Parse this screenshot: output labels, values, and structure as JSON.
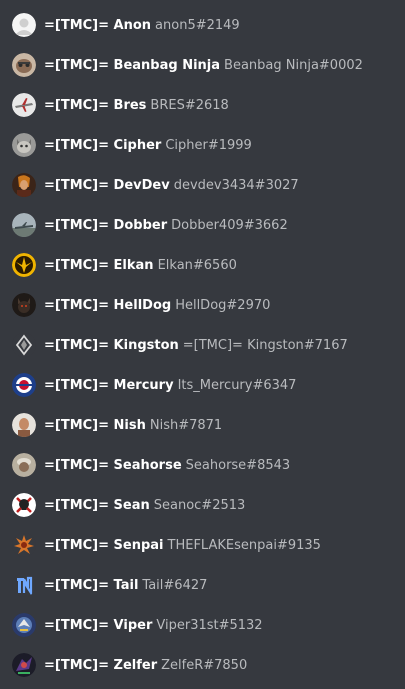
{
  "members": [
    {
      "nickname": "=[TMC]= Anon",
      "username": "anon5#2149",
      "avatar_icon": "default-user-avatar-icon"
    },
    {
      "nickname": "=[TMC]= Beanbag Ninja",
      "username": "Beanbag Ninja#0002",
      "avatar_icon": "cat-avatar-icon"
    },
    {
      "nickname": "=[TMC]= Bres",
      "username": "BRES#2618",
      "avatar_icon": "airplane-avatar-icon"
    },
    {
      "nickname": "=[TMC]= Cipher",
      "username": "Cipher#1999",
      "avatar_icon": "cat-avatar-icon"
    },
    {
      "nickname": "=[TMC]= DevDev",
      "username": "devdev3434#3027",
      "avatar_icon": "character-avatar-icon"
    },
    {
      "nickname": "=[TMC]= Dobber",
      "username": "Dobber409#3662",
      "avatar_icon": "jet-avatar-icon"
    },
    {
      "nickname": "=[TMC]= Elkan",
      "username": "Elkan#6560",
      "avatar_icon": "emblem-avatar-icon"
    },
    {
      "nickname": "=[TMC]= HellDog",
      "username": "HellDog#2970",
      "avatar_icon": "dog-avatar-icon"
    },
    {
      "nickname": "=[TMC]= Kingston",
      "username": "=[TMC]= Kingston#7167",
      "avatar_icon": "wings-logo-avatar-icon"
    },
    {
      "nickname": "=[TMC]= Mercury",
      "username": "Its_Mercury#6347",
      "avatar_icon": "roundel-avatar-icon"
    },
    {
      "nickname": "=[TMC]= Nish",
      "username": "Nish#7871",
      "avatar_icon": "photo-avatar-icon"
    },
    {
      "nickname": "=[TMC]= Seahorse",
      "username": "Seahorse#8543",
      "avatar_icon": "photo-avatar-icon"
    },
    {
      "nickname": "=[TMC]= Sean",
      "username": "Seanoc#2513",
      "avatar_icon": "skull-avatar-icon"
    },
    {
      "nickname": "=[TMC]= Senpai",
      "username": "THEFLAKEsenpai#9135",
      "avatar_icon": "splash-avatar-icon"
    },
    {
      "nickname": "=[TMC]= Tail",
      "username": "Tail#6427",
      "avatar_icon": "letter-logo-avatar-icon"
    },
    {
      "nickname": "=[TMC]= Viper",
      "username": "Viper31st#5132",
      "avatar_icon": "squadron-badge-avatar-icon"
    },
    {
      "nickname": "=[TMC]= Zelfer",
      "username": "ZelfeR#7850",
      "avatar_icon": "character-avatar-icon"
    }
  ]
}
